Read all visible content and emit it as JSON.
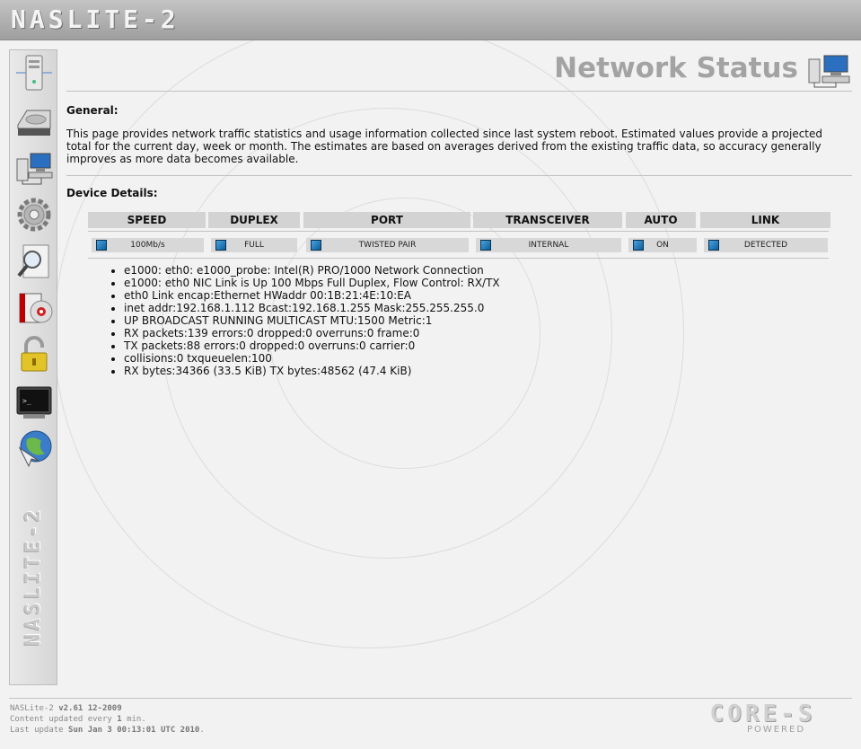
{
  "app": {
    "logo_text": "NASLITE-2"
  },
  "sidebar": {
    "brand_text": "NASLITE-2",
    "items": [
      {
        "icon": "server-icon"
      },
      {
        "icon": "hard-drive-icon"
      },
      {
        "icon": "network-computers-icon"
      },
      {
        "icon": "gear-icon"
      },
      {
        "icon": "magnifier-icon"
      },
      {
        "icon": "cd-box-icon"
      },
      {
        "icon": "padlock-icon"
      },
      {
        "icon": "terminal-icon"
      },
      {
        "icon": "globe-icon"
      }
    ]
  },
  "page": {
    "title": "Network Status",
    "general_heading": "General:",
    "general_text": "This page provides network traffic statistics and usage information collected since last system reboot. Estimated values provide a projected total for the current day, week or month. The estimates are based on averages derived from the existing traffic data, so accuracy generally improves as more data becomes available.",
    "device_heading": "Device Details:"
  },
  "device_table": {
    "headers": [
      "SPEED",
      "DUPLEX",
      "PORT",
      "TRANSCEIVER",
      "AUTO",
      "LINK"
    ],
    "values": [
      "100Mb/s",
      "FULL",
      "TWISTED PAIR",
      "INTERNAL",
      "ON",
      "DETECTED"
    ],
    "led_color": "#1f7fc4"
  },
  "details": [
    "e1000: eth0: e1000_probe: Intel(R) PRO/1000 Network Connection",
    "e1000: eth0 NIC Link is Up 100 Mbps Full Duplex, Flow Control: RX/TX",
    "eth0 Link encap:Ethernet HWaddr 00:1B:21:4E:10:EA",
    "inet addr:192.168.1.112 Bcast:192.168.1.255 Mask:255.255.255.0",
    "UP BROADCAST RUNNING MULTICAST MTU:1500 Metric:1",
    "RX packets:139 errors:0 dropped:0 overruns:0 frame:0",
    "TX packets:88 errors:0 dropped:0 overruns:0 carrier:0",
    "collisions:0 txqueuelen:100",
    "RX bytes:34366 (33.5 KiB) TX bytes:48562 (47.4 KiB)"
  ],
  "footer": {
    "product_label": "NASLite-2",
    "version": "v2.61 12-2009",
    "update_prefix": "Content updated every",
    "update_interval": "1",
    "update_suffix": "min.",
    "last_update_label": "Last update",
    "last_update": "Sun Jan 3 00:13:01 UTC 2010",
    "core_logo": "CORE-S",
    "core_sub": "POWERED"
  }
}
